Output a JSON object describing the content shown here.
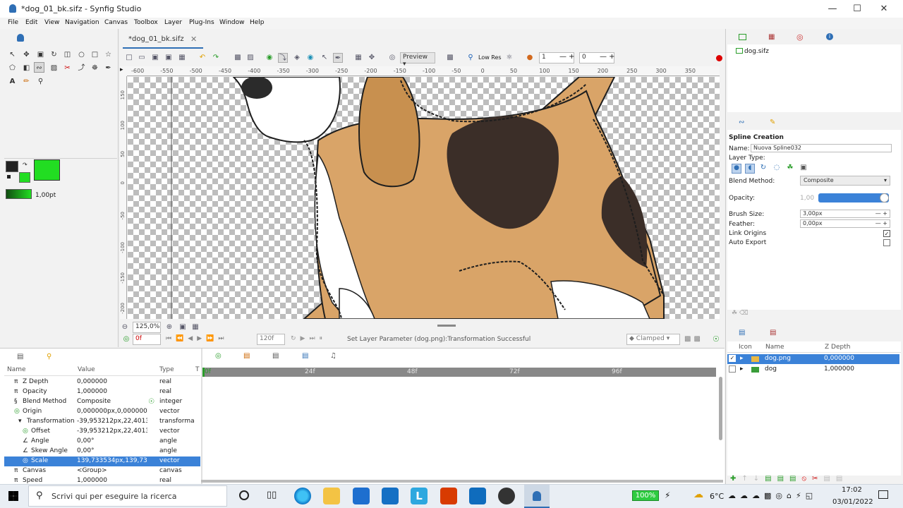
{
  "window": {
    "title": "*dog_01_bk.sifz - Synfig Studio"
  },
  "menu": [
    "File",
    "Edit",
    "View",
    "Navigation",
    "Canvas",
    "Toolbox",
    "Layer",
    "Plug-Ins",
    "Window",
    "Help"
  ],
  "canvas": {
    "tab": "*dog_01_bk.sifz",
    "preview": "Preview",
    "lowres": "Low Res",
    "onion_past": "1",
    "onion_future": "0",
    "ruler_h": [
      "-600",
      "-550",
      "-500",
      "-450",
      "-400",
      "-350",
      "-300",
      "-250",
      "-200",
      "-150",
      "-100",
      "-50",
      "0",
      "50",
      "100",
      "150",
      "200",
      "250",
      "300",
      "350"
    ],
    "ruler_v": [
      "150",
      "100",
      "50",
      "0",
      "-50",
      "-100",
      "-150",
      "-200"
    ],
    "zoom": "125,0%",
    "frame": "0f",
    "end_frame": "120f",
    "status": "Set Layer Parameter (dog.png):Transformation Successful",
    "interp": "Clamped"
  },
  "toolbox": {
    "brush_size": "1,00pt",
    "fill_color": "#22dd22",
    "outline_color": "#222222"
  },
  "canvas_browser": {
    "file": "dog.sifz"
  },
  "tool_options": {
    "title": "Spline Creation",
    "name_label": "Name:",
    "name_value": "Nuova Spline032",
    "layer_type": "Layer Type:",
    "blend_label": "Blend Method:",
    "blend_value": "Composite",
    "opacity_label": "Opacity:",
    "opacity_value": "1,00",
    "brush_label": "Brush Size:",
    "brush_value": "3,00px",
    "feather_label": "Feather:",
    "feather_value": "0,00px",
    "link_label": "Link Origins",
    "autoexport_label": "Auto Export"
  },
  "params": {
    "headers": [
      "Name",
      "Value",
      "Type",
      "T"
    ],
    "rows": [
      {
        "name": "Z Depth",
        "value": "0,000000",
        "type": "real"
      },
      {
        "name": "Opacity",
        "value": "1,000000",
        "type": "real"
      },
      {
        "name": "Blend Method",
        "value": "Composite",
        "type": "integer"
      },
      {
        "name": "Origin",
        "value": "0,000000px,0,000000p",
        "type": "vector"
      },
      {
        "name": "Transformation",
        "value": "-39,953212px,22,4013",
        "type": "transforma"
      },
      {
        "name": "Offset",
        "value": "-39,953212px,22,4013",
        "type": "vector"
      },
      {
        "name": "Angle",
        "value": "0,00°",
        "type": "angle"
      },
      {
        "name": "Skew Angle",
        "value": "0,00°",
        "type": "angle"
      },
      {
        "name": "Scale",
        "value": "139,733534px,139,73:",
        "type": "vector"
      },
      {
        "name": "Canvas",
        "value": "<Group>",
        "type": "canvas"
      },
      {
        "name": "Speed",
        "value": "1,000000",
        "type": "real"
      }
    ]
  },
  "timetrack": {
    "marks": [
      "0f",
      "24f",
      "48f",
      "72f",
      "96f"
    ]
  },
  "layers": {
    "headers": [
      "Icon",
      "Name",
      "Z Depth"
    ],
    "rows": [
      {
        "name": "dog.png",
        "z": "0,000000"
      },
      {
        "name": "dog",
        "z": "1,000000"
      }
    ]
  },
  "taskbar": {
    "search": "Scrivi qui per eseguire la ricerca",
    "battery": "100%",
    "temp": "6°C",
    "time": "17:02",
    "date": "03/01/2022"
  }
}
